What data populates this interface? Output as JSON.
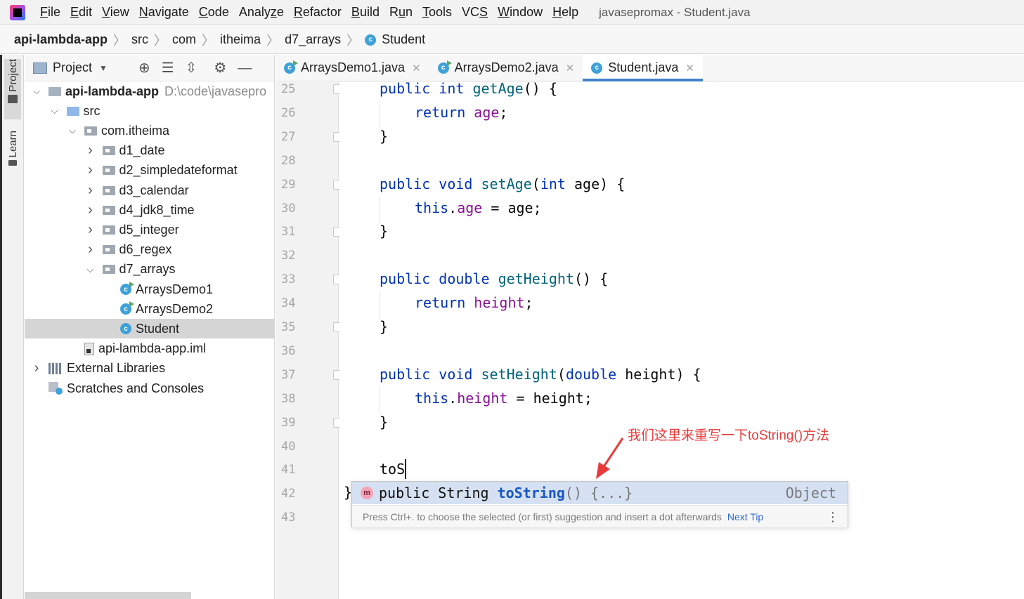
{
  "window": {
    "title": "javasepromax - Student.java"
  },
  "menu": [
    {
      "mn": "F",
      "rest": "ile"
    },
    {
      "mn": "E",
      "rest": "dit"
    },
    {
      "mn": "V",
      "rest": "iew"
    },
    {
      "mn": "N",
      "rest": "avigate"
    },
    {
      "mn": "C",
      "rest": "ode"
    },
    {
      "mn": "",
      "rest": "Analy",
      "mn2": "z",
      "rest2": "e"
    },
    {
      "mn": "R",
      "rest": "efactor"
    },
    {
      "mn": "B",
      "rest": "uild"
    },
    {
      "mn": "",
      "rest": "R",
      "mn2": "u",
      "rest2": "n"
    },
    {
      "mn": "T",
      "rest": "ools"
    },
    {
      "mn": "",
      "rest": "VC",
      "mn2": "S",
      "rest2": ""
    },
    {
      "mn": "W",
      "rest": "indow"
    },
    {
      "mn": "H",
      "rest": "elp"
    }
  ],
  "breadcrumb": [
    "api-lambda-app",
    "src",
    "com",
    "itheima",
    "d7_arrays",
    "Student"
  ],
  "side_tabs": {
    "project": "Project",
    "learn": "Learn"
  },
  "project_panel": {
    "title": "Project",
    "tree": [
      {
        "label": "api-lambda-app",
        "hint": "D:\\code\\javasepro",
        "level": 0,
        "chev": "v",
        "icon": "module",
        "bold": true
      },
      {
        "label": "src",
        "level": 1,
        "chev": "v",
        "icon": "blue"
      },
      {
        "label": "com.itheima",
        "level": 2,
        "chev": "v",
        "icon": "grey"
      },
      {
        "label": "d1_date",
        "level": 3,
        "chev": ">",
        "icon": "grey"
      },
      {
        "label": "d2_simpledateformat",
        "level": 3,
        "chev": ">",
        "icon": "grey"
      },
      {
        "label": "d3_calendar",
        "level": 3,
        "chev": ">",
        "icon": "grey"
      },
      {
        "label": "d4_jdk8_time",
        "level": 3,
        "chev": ">",
        "icon": "grey"
      },
      {
        "label": "d5_integer",
        "level": 3,
        "chev": ">",
        "icon": "grey"
      },
      {
        "label": "d6_regex",
        "level": 3,
        "chev": ">",
        "icon": "grey"
      },
      {
        "label": "d7_arrays",
        "level": 3,
        "chev": "v",
        "icon": "grey"
      },
      {
        "label": "ArraysDemo1",
        "level": 4,
        "chev": "",
        "icon": "class-run"
      },
      {
        "label": "ArraysDemo2",
        "level": 4,
        "chev": "",
        "icon": "class-run"
      },
      {
        "label": "Student",
        "level": 4,
        "chev": "",
        "icon": "class",
        "selected": true
      },
      {
        "label": "api-lambda-app.iml",
        "level": 2,
        "chev": "",
        "icon": "iml"
      },
      {
        "label": "External Libraries",
        "level": 0,
        "chev": ">",
        "icon": "libs"
      },
      {
        "label": "Scratches and Consoles",
        "level": 0,
        "chev": "",
        "icon": "scratch"
      }
    ]
  },
  "tabs": [
    {
      "label": "ArraysDemo1.java",
      "icon": "class-run",
      "active": false
    },
    {
      "label": "ArraysDemo2.java",
      "icon": "class-run",
      "active": false
    },
    {
      "label": "Student.java",
      "icon": "class",
      "active": true
    }
  ],
  "line_numbers": [
    "25",
    "26",
    "27",
    "28",
    "29",
    "30",
    "31",
    "32",
    "33",
    "34",
    "35",
    "36",
    "37",
    "38",
    "39",
    "40",
    "41",
    "42",
    "43"
  ],
  "code_lines": [
    {
      "line": "25",
      "indent": 0,
      "tokens": [
        [
          "kw",
          "public "
        ],
        [
          "kw",
          "int "
        ],
        [
          "fn",
          "getAge"
        ],
        [
          "plain",
          "() {"
        ]
      ]
    },
    {
      "line": "26",
      "indent": 1,
      "tokens": [
        [
          "kw",
          "return "
        ],
        [
          "fld",
          "age"
        ],
        [
          "plain",
          ";"
        ]
      ]
    },
    {
      "line": "27",
      "indent": 0,
      "tokens": [
        [
          "plain",
          "}"
        ]
      ]
    },
    {
      "line": "29",
      "indent": 0,
      "tokens": [
        [
          "kw",
          "public "
        ],
        [
          "kw",
          "void "
        ],
        [
          "fn",
          "setAge"
        ],
        [
          "plain",
          "("
        ],
        [
          "kw",
          "int "
        ],
        [
          "plain",
          "age) {"
        ]
      ]
    },
    {
      "line": "30",
      "indent": 1,
      "tokens": [
        [
          "kw",
          "this"
        ],
        [
          "plain",
          "."
        ],
        [
          "fld",
          "age"
        ],
        [
          "plain",
          " = age;"
        ]
      ]
    },
    {
      "line": "31",
      "indent": 0,
      "tokens": [
        [
          "plain",
          "}"
        ]
      ]
    },
    {
      "line": "33",
      "indent": 0,
      "tokens": [
        [
          "kw",
          "public "
        ],
        [
          "kw",
          "double "
        ],
        [
          "fn",
          "getHeight"
        ],
        [
          "plain",
          "() {"
        ]
      ]
    },
    {
      "line": "34",
      "indent": 1,
      "tokens": [
        [
          "kw",
          "return "
        ],
        [
          "fld",
          "height"
        ],
        [
          "plain",
          ";"
        ]
      ]
    },
    {
      "line": "35",
      "indent": 0,
      "tokens": [
        [
          "plain",
          "}"
        ]
      ]
    },
    {
      "line": "37",
      "indent": 0,
      "tokens": [
        [
          "kw",
          "public "
        ],
        [
          "kw",
          "void "
        ],
        [
          "fn",
          "setHeight"
        ],
        [
          "plain",
          "("
        ],
        [
          "kw",
          "double "
        ],
        [
          "plain",
          "height) {"
        ]
      ]
    },
    {
      "line": "38",
      "indent": 1,
      "tokens": [
        [
          "kw",
          "this"
        ],
        [
          "plain",
          "."
        ],
        [
          "fld",
          "height"
        ],
        [
          "plain",
          " = height;"
        ]
      ]
    },
    {
      "line": "39",
      "indent": 0,
      "tokens": [
        [
          "plain",
          "}"
        ]
      ]
    },
    {
      "line": "41",
      "indent": 0,
      "tokens": [
        [
          "plain",
          "toS"
        ]
      ]
    }
  ],
  "closing_brace": "}",
  "completion": {
    "icon": "m",
    "prefix": "public String ",
    "name": "toString",
    "suffix": "() {...}",
    "type": "Object",
    "hint": "Press Ctrl+. to choose the selected (or first) suggestion and insert a dot afterwards",
    "next_tip": "Next Tip"
  },
  "annotation": "我们这里来重写一下toString()方法",
  "colors": {
    "keyword": "#0033b3",
    "method": "#00627a",
    "field": "#871094",
    "annotation": "#e83a3a",
    "tab_underline": "#4083c9"
  }
}
